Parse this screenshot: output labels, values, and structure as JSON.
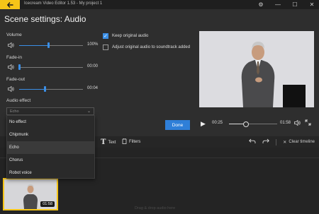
{
  "window": {
    "title": "Icecream Video Editor 1.53 - My project 1"
  },
  "panel": {
    "title": "Scene settings: Audio",
    "volume": {
      "label": "Volume",
      "value_text": "100%",
      "level": 0.46
    },
    "fade_in": {
      "label": "Fade-in",
      "value_text": "00:00",
      "level": 0.0
    },
    "fade_out": {
      "label": "Fade-out",
      "value_text": "00:04",
      "level": 0.4
    },
    "audio_effect": {
      "label": "Audio effect",
      "selected": "Echo"
    },
    "keep_original": {
      "label": "Keep original audio",
      "checked": true
    },
    "adjust_original": {
      "label": "Adjust original audio to soundtrack added",
      "checked": false
    },
    "done_label": "Done"
  },
  "dropdown": {
    "options": [
      "No effect",
      "Chipmunk",
      "Echo",
      "Chorus",
      "Robot voice"
    ],
    "selected_index": 2
  },
  "player": {
    "current_time": "00:25",
    "total_time": "01:58",
    "progress": 0.35
  },
  "timeline_toolbar": {
    "text_label": "Text",
    "filters_label": "Filters",
    "clear_label": "Clear timeline"
  },
  "timeline": {
    "clip_duration": "01:58",
    "drop_hint": "Drag & drop audio here"
  },
  "colors": {
    "accent": "#f5c518",
    "blue": "#2f7fd8",
    "background": "#2e2e2e"
  }
}
